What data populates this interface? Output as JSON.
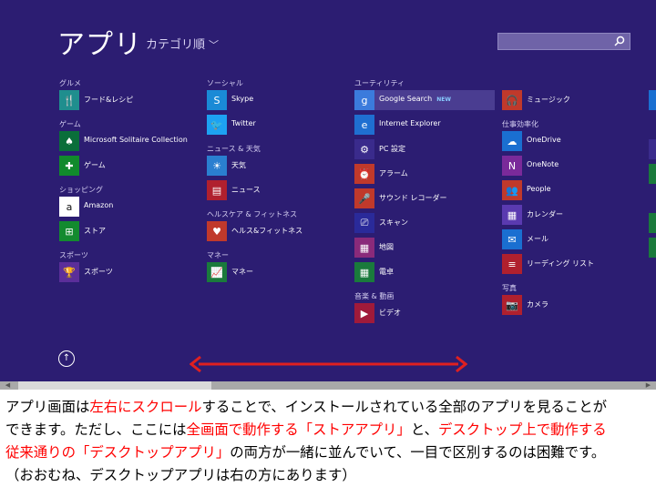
{
  "screen": {
    "title": "アプリ",
    "sort_label": "カテゴリ順",
    "sort_chevron": "﹀",
    "columns": [
      {
        "groups": [
          {
            "label": "グルメ",
            "items": [
              {
                "label": "フード&レシピ",
                "icon": "fork-knife-icon",
                "color": "#1f8e8e"
              }
            ]
          },
          {
            "label": "ゲーム",
            "items": [
              {
                "label": "Microsoft Solitaire Collection",
                "icon": "cards-icon",
                "color": "#0a6e3a"
              },
              {
                "label": "ゲーム",
                "icon": "gamepad-icon",
                "color": "#118a2c"
              }
            ]
          },
          {
            "label": "ショッピング",
            "items": [
              {
                "label": "Amazon",
                "icon": "amazon-icon",
                "color": "#ffffff"
              },
              {
                "label": "ストア",
                "icon": "store-icon",
                "color": "#138a2f"
              }
            ]
          },
          {
            "label": "スポーツ",
            "items": [
              {
                "label": "スポーツ",
                "icon": "trophy-icon",
                "color": "#5b2e9a"
              }
            ]
          }
        ]
      },
      {
        "groups": [
          {
            "label": "ソーシャル",
            "items": [
              {
                "label": "Skype",
                "icon": "skype-icon",
                "color": "#1a8ad6"
              },
              {
                "label": "Twitter",
                "icon": "twitter-icon",
                "color": "#1da1f2"
              }
            ]
          },
          {
            "label": "ニュース & 天気",
            "items": [
              {
                "label": "天気",
                "icon": "weather-icon",
                "color": "#2a7fd0"
              },
              {
                "label": "ニュース",
                "icon": "news-icon",
                "color": "#b0202e"
              }
            ]
          },
          {
            "label": "ヘルスケア & フィットネス",
            "items": [
              {
                "label": "ヘルス&フィットネス",
                "icon": "heart-icon",
                "color": "#c0392b"
              }
            ]
          },
          {
            "label": "マネー",
            "items": [
              {
                "label": "マネー",
                "icon": "chart-icon",
                "color": "#1a7a3c"
              }
            ]
          }
        ]
      },
      {
        "groups": [
          {
            "label": "ユーティリティ",
            "items": [
              {
                "label": "Google Search",
                "badge": "NEW",
                "icon": "google-icon",
                "color": "#3b7bdc",
                "highlight": true
              },
              {
                "label": "Internet Explorer",
                "icon": "ie-icon",
                "color": "#1f6fd1"
              },
              {
                "label": "PC 設定",
                "icon": "gear-icon",
                "color": "#3a2b8c"
              },
              {
                "label": "アラーム",
                "icon": "alarm-icon",
                "color": "#c0392b"
              },
              {
                "label": "サウンド レコーダー",
                "icon": "mic-icon",
                "color": "#c0392b"
              },
              {
                "label": "スキャン",
                "icon": "scan-icon",
                "color": "#2a2a9a"
              },
              {
                "label": "地図",
                "icon": "map-icon",
                "color": "#8a2a7a"
              },
              {
                "label": "電卓",
                "icon": "calculator-icon",
                "color": "#1a7a3c"
              }
            ]
          },
          {
            "label": "音楽 & 動画",
            "items": [
              {
                "label": "ビデオ",
                "icon": "video-icon",
                "color": "#a01a3a"
              }
            ]
          }
        ]
      },
      {
        "groups": [
          {
            "label": "",
            "items": [
              {
                "label": "ミュージック",
                "icon": "headphones-icon",
                "color": "#c0392b"
              }
            ]
          },
          {
            "label": "仕事効率化",
            "items": [
              {
                "label": "OneDrive",
                "icon": "cloud-icon",
                "color": "#1a6fd1"
              },
              {
                "label": "OneNote",
                "icon": "onenote-icon",
                "color": "#7a2a9a"
              },
              {
                "label": "People",
                "icon": "people-icon",
                "color": "#c0392b"
              },
              {
                "label": "カレンダー",
                "icon": "calendar-icon",
                "color": "#5a3ab0"
              },
              {
                "label": "メール",
                "icon": "mail-icon",
                "color": "#1a6fd1"
              },
              {
                "label": "リーディング リスト",
                "icon": "reading-icon",
                "color": "#b0202e"
              }
            ]
          },
          {
            "label": "写真",
            "items": [
              {
                "label": "カメラ",
                "icon": "camera-icon",
                "color": "#b0202e"
              }
            ]
          }
        ]
      }
    ]
  },
  "caption": {
    "line1": [
      {
        "t": "アプリ画面は"
      },
      {
        "t": "左右にスクロール",
        "red": true
      },
      {
        "t": "することで、インストールされている全部のアプリを見ることが"
      }
    ],
    "line2": [
      {
        "t": "できます。ただし、ここには"
      },
      {
        "t": "全画面で動作する「ストアアプリ」",
        "red": true
      },
      {
        "t": "と、"
      },
      {
        "t": "デスクトップ上で動作する",
        "red": true
      }
    ],
    "line3": [
      {
        "t": "従来通りの「デスクトップアプリ」",
        "red": true
      },
      {
        "t": "の両方が一緒に並んでいて、一目で区別するのは困難です。"
      }
    ],
    "line4": [
      {
        "t": "（おおむね、デスクトップアプリは右の方にあります）"
      }
    ]
  },
  "colors": {
    "background": "#2c1d72",
    "accent_red": "#ff0000"
  }
}
